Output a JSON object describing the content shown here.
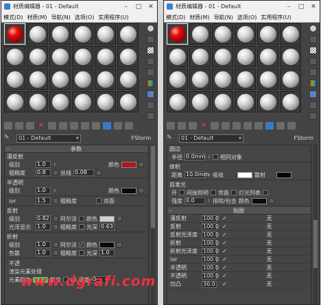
{
  "left_window": {
    "title": "材质编辑器 - 01 - Default",
    "menu": [
      "模式(D)",
      "材质(M)",
      "导航(N)",
      "选项(O)",
      "实用程序(U)"
    ],
    "material_name": "01 - Default",
    "material_type": "FStorm",
    "rollout_title": "参数",
    "groups": {
      "diffuse": "漫反射",
      "translucency": "半透明",
      "reflection": "反射",
      "refraction": "折射"
    },
    "diffuse": {
      "level_label": "级别",
      "level_value": "1.0",
      "color_label": "颜色",
      "color": "#b01818",
      "roughness_label": "粗糙度",
      "roughness_value": "0.8",
      "fiber_label": "丝线",
      "fiber_value": "0.08"
    },
    "translucency": {
      "level_label": "级别",
      "level_value": "1.0",
      "color_label": "颜色",
      "color": "#080808"
    },
    "ior": {
      "label": "ior",
      "value": "1.5",
      "roughness_label": "粗糙度",
      "two_sided_label": "双面"
    },
    "reflection": {
      "level_label": "级别",
      "level_value": "0.82",
      "fresnel_label": "阿尔法",
      "color_label": "颜色",
      "color": "#cfcfcf",
      "gloss_label": "光泽显示",
      "gloss_value": "1.0",
      "roughness_label": "粗糙度",
      "depth_label": "光深",
      "depth_value": "0.63"
    },
    "refraction": {
      "level_label": "级别",
      "level_value": "1.0",
      "fresnel_label": "阿尔法",
      "color_label": "颜色",
      "color": "#0a0a0a",
      "dispersion_label": "色散",
      "dispersion_value": "1.0",
      "roughness_label": "粗糙度",
      "depth_label": "光深",
      "depth_value": "1.0"
    },
    "bottom_rows": {
      "opacity": "不透",
      "render_elements": "渲染元素处理",
      "element_color": "元素颜色",
      "element_color_swatch": "#55cc44",
      "transfer": "转变",
      "id_channel": "ID 通道",
      "id_value": "0"
    }
  },
  "right_window": {
    "title": "材质编辑器 - 01 - Default",
    "menu": [
      "模式(D)",
      "材质(M)",
      "导航(N)",
      "选项(O)",
      "实用程序(U)"
    ],
    "material_name": "01 - Default",
    "material_type": "FStorm",
    "rounded": {
      "group": "圆边",
      "radius_label": "半径",
      "radius_value": "0.0mm",
      "same_object_label": "相同对象"
    },
    "volume": {
      "group": "体积",
      "distance_label": "距离",
      "distance_value": "10.0mm",
      "absorb_label": "吸收",
      "absorb_color": "#ffffff",
      "scatter_label": "散射",
      "scatter_color": "#050505"
    },
    "emission": {
      "group": "自发光",
      "on_label": "开",
      "pass_label": "间接照明",
      "back_label": "背面",
      "lights_label": "灯光列表",
      "intensity_label": "强度",
      "intensity_value": "0.0",
      "exclude_label": "排除/包含",
      "color_label": "颜色",
      "color": "#0a0a0a"
    },
    "maps_rollout_title": "贴图",
    "maps": [
      {
        "label": "漫反射",
        "value": "100.0",
        "map": "无"
      },
      {
        "label": "反射",
        "value": "100.0",
        "map": "无"
      },
      {
        "label": "反射光泽度",
        "value": "100.0",
        "map": "无"
      },
      {
        "label": "折射",
        "value": "100.0",
        "map": "无"
      },
      {
        "label": "折射光泽度",
        "value": "100.0",
        "map": "无"
      },
      {
        "label": "ior",
        "value": "100.0",
        "map": "无"
      },
      {
        "label": "半透明",
        "value": "100.0",
        "map": "无"
      },
      {
        "label": "不透明",
        "value": "100.0",
        "map": "无"
      },
      {
        "label": "凹凸",
        "value": "30.0",
        "map": "无"
      }
    ]
  },
  "watermark": "www.dgrafi.com"
}
